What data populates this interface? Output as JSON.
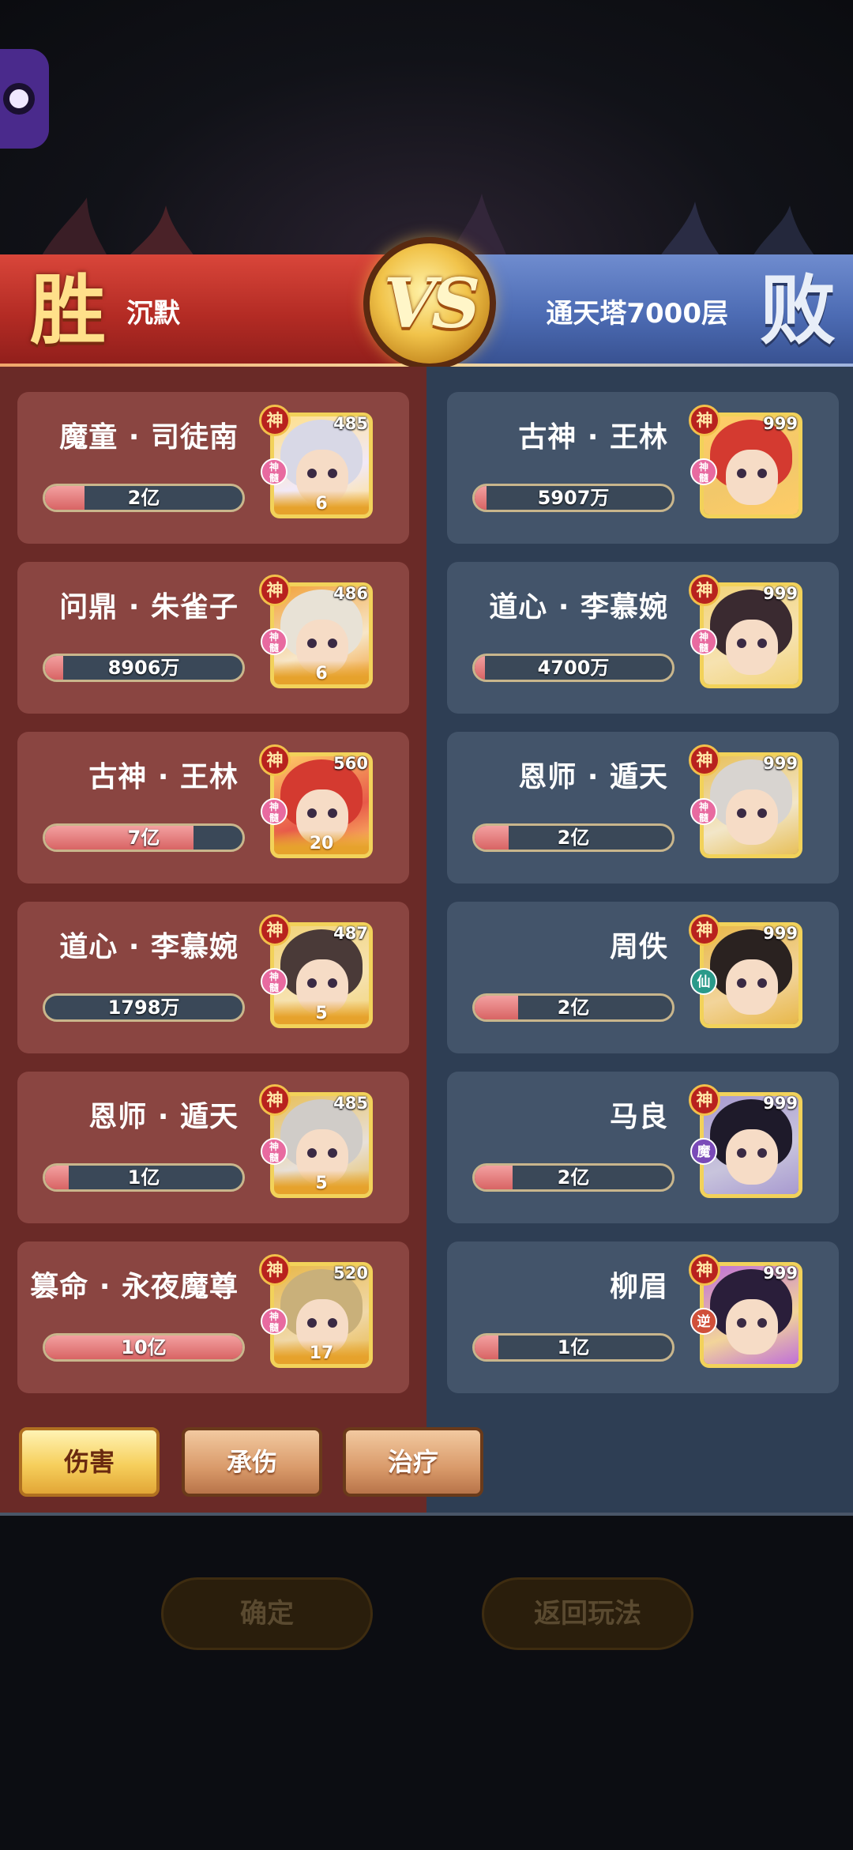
{
  "header": {
    "left_result": "胜",
    "right_result": "败",
    "left_player": "沉默",
    "right_player": "通天塔7000层",
    "vs_label": "VS"
  },
  "left_team": [
    {
      "name": "魔童 · 司徒南",
      "level": "485",
      "value": "2亿",
      "fill": 0.2,
      "stars": "6",
      "sub": "神\n髓",
      "sub_color": "#e86aa0",
      "palette": [
        "#f2e9f7",
        "#d8d8e6",
        "#ffe08a"
      ]
    },
    {
      "name": "问鼎 · 朱雀子",
      "level": "486",
      "value": "8906万",
      "fill": 0.09,
      "stars": "6",
      "sub": "神\n髓",
      "sub_color": "#e86aa0",
      "palette": [
        "#f7e6c8",
        "#e8e2d6",
        "#f2a23a"
      ]
    },
    {
      "name": "古神 · 王林",
      "level": "560",
      "value": "7亿",
      "fill": 0.75,
      "stars": "20",
      "sub": "神\n髓",
      "sub_color": "#e86aa0",
      "palette": [
        "#e85a4a",
        "#d43a30",
        "#ffcc66"
      ]
    },
    {
      "name": "道心 · 李慕婉",
      "level": "487",
      "value": "1798万",
      "fill": 0.0,
      "stars": "5",
      "sub": "神\n髓",
      "sub_color": "#e86aa0",
      "palette": [
        "#f6e2b0",
        "#4a3a38",
        "#f2d47a"
      ]
    },
    {
      "name": "恩师 · 遁天",
      "level": "485",
      "value": "1亿",
      "fill": 0.12,
      "stars": "5",
      "sub": "神\n髓",
      "sub_color": "#e86aa0",
      "palette": [
        "#e8e0d8",
        "#d0ccc8",
        "#e8c05a"
      ]
    },
    {
      "name": "篡命 · 永夜魔尊",
      "level": "520",
      "value": "10亿",
      "fill": 1.0,
      "stars": "17",
      "sub": "神\n髓",
      "sub_color": "#e86aa0",
      "palette": [
        "#f0d8a8",
        "#c9b07a",
        "#e8b84a"
      ]
    }
  ],
  "right_team": [
    {
      "name": "古神 · 王林",
      "level": "999",
      "value": "5907万",
      "fill": 0.06,
      "sub": "神\n髓",
      "sub_color": "#e86aa0",
      "palette": [
        "#f2c86a",
        "#d43a30",
        "#ffcc66"
      ]
    },
    {
      "name": "道心 · 李慕婉",
      "level": "999",
      "value": "4700万",
      "fill": 0.05,
      "sub": "神\n髓",
      "sub_color": "#e86aa0",
      "palette": [
        "#f6e2b0",
        "#3a2a30",
        "#f2d47a"
      ]
    },
    {
      "name": "恩师 · 遁天",
      "level": "999",
      "value": "2亿",
      "fill": 0.17,
      "sub": "神\n髓",
      "sub_color": "#e86aa0",
      "palette": [
        "#f2e6c8",
        "#d8d4d0",
        "#e8c05a"
      ]
    },
    {
      "name": "周佚",
      "level": "999",
      "value": "2亿",
      "fill": 0.22,
      "sub": "仙",
      "sub_color": "#2a9a8a",
      "palette": [
        "#f2d49a",
        "#2a2220",
        "#e8b84a"
      ]
    },
    {
      "name": "马良",
      "level": "999",
      "value": "2亿",
      "fill": 0.19,
      "sub": "魔",
      "sub_color": "#7a4ab8",
      "palette": [
        "#c8c4dc",
        "#1e1a2a",
        "#a89ad0"
      ]
    },
    {
      "name": "柳眉",
      "level": "999",
      "value": "1亿",
      "fill": 0.12,
      "sub": "逆",
      "sub_color": "#d0503a",
      "palette": [
        "#f2d49a",
        "#2a1e3a",
        "#c070d8"
      ]
    }
  ],
  "god_badge": "神",
  "tabs": [
    {
      "label": "伤害",
      "active": true
    },
    {
      "label": "承伤",
      "active": false
    },
    {
      "label": "治疗",
      "active": false
    }
  ],
  "buttons": {
    "confirm": "确定",
    "back": "返回玩法"
  },
  "colors": {
    "win_red": "#b32b24",
    "lose_blue": "#4c6bb3",
    "gold": "#f2d25a"
  }
}
